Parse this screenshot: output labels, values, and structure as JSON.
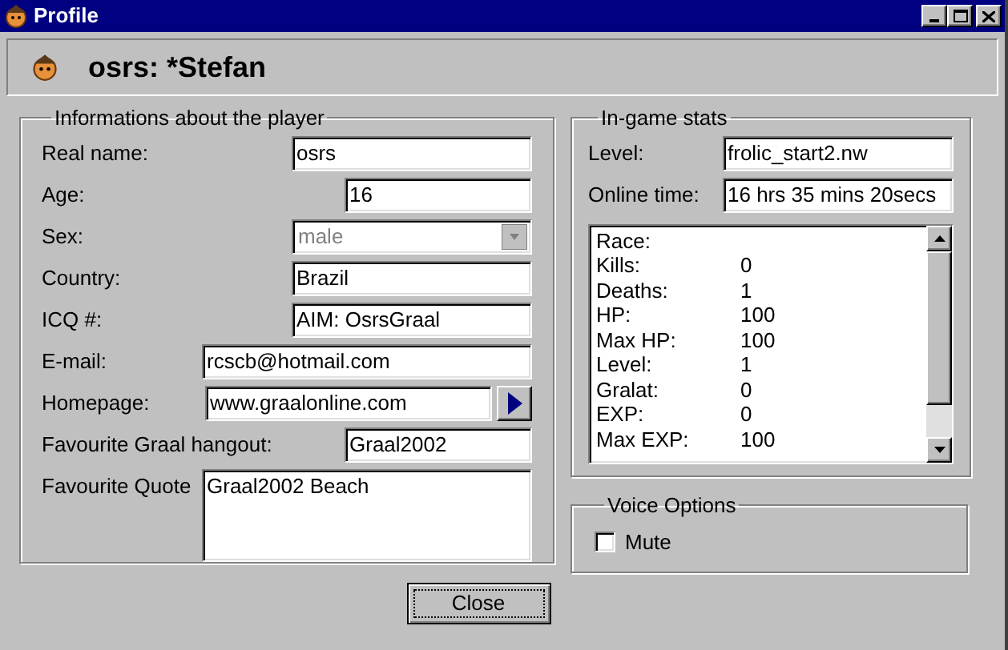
{
  "window": {
    "title": "Profile"
  },
  "header": {
    "title": "osrs: *Stefan"
  },
  "player_info": {
    "title": "Informations about the player",
    "fields": [
      {
        "kind": "text",
        "label": "Real name:",
        "value": "osrs"
      },
      {
        "kind": "text",
        "label": "Age:",
        "value": "16"
      },
      {
        "kind": "combo",
        "label": "Sex:",
        "value": "male",
        "disabled": true
      },
      {
        "kind": "text",
        "label": "Country:",
        "value": "Brazil"
      },
      {
        "kind": "text",
        "label": "ICQ #:",
        "value": "AIM: OsrsGraal"
      },
      {
        "kind": "text",
        "label": "E-mail:",
        "value": "rcscb@hotmail.com"
      },
      {
        "kind": "link",
        "label": "Homepage:",
        "value": "www.graalonline.com"
      },
      {
        "kind": "text",
        "label": "Favourite Graal hangout:",
        "value": "Graal2002"
      },
      {
        "kind": "multiline",
        "label": "Favourite Quote",
        "value": "Graal2002 Beach"
      }
    ]
  },
  "stats": {
    "title": "In-game stats",
    "fields": [
      {
        "label": "Level:",
        "value": "frolic_start2.nw"
      },
      {
        "label": "Online time:",
        "value": "16 hrs 35 mins 20secs"
      }
    ],
    "list": [
      {
        "name": "Race:"
      },
      {
        "name": "Kills:",
        "value": "0"
      },
      {
        "name": "Deaths:",
        "value": "1"
      },
      {
        "name": "HP:",
        "value": "100"
      },
      {
        "name": "Max HP:",
        "value": "100"
      },
      {
        "name": "Level:",
        "value": "1"
      },
      {
        "name": "Gralat:",
        "value": "0"
      },
      {
        "name": "EXP:",
        "value": "0"
      },
      {
        "name": "Max EXP:",
        "value": "100"
      }
    ]
  },
  "voice": {
    "title": "Voice Options",
    "mute": {
      "label": "Mute",
      "checked": false
    }
  },
  "buttons": [
    {
      "label": "Close"
    }
  ]
}
